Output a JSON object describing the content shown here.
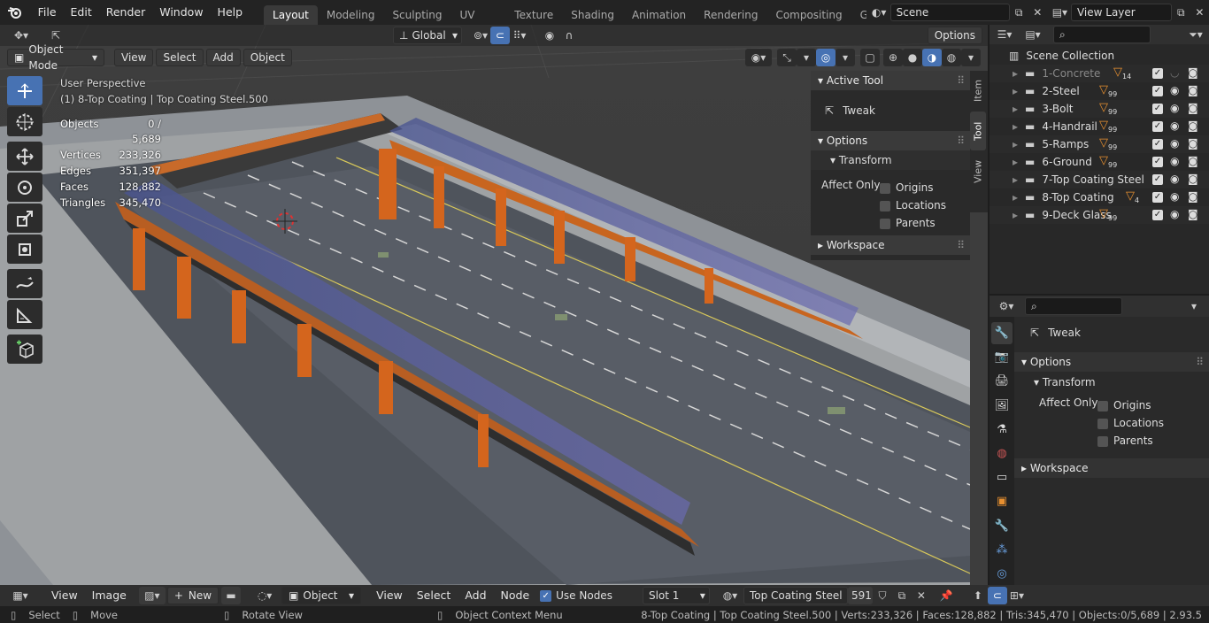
{
  "topbar": {
    "menus": [
      "File",
      "Edit",
      "Render",
      "Window",
      "Help"
    ],
    "workspaces": [
      "Layout",
      "Modeling",
      "Sculpting",
      "UV Editing",
      "Texture Paint",
      "Shading",
      "Animation",
      "Rendering",
      "Compositing",
      "Geometry Nod"
    ],
    "active_workspace": "Layout",
    "scene": "Scene",
    "view_layer": "View Layer"
  },
  "viewport": {
    "orientation": "Global",
    "options_label": "Options",
    "mode": "Object Mode",
    "menus": [
      "View",
      "Select",
      "Add",
      "Object"
    ],
    "overlay_title": "User Perspective",
    "overlay_subtitle": "(1) 8-Top Coating | Top Coating Steel.500",
    "stats": [
      {
        "k": "Objects",
        "v": "0 / 5,689"
      },
      {
        "k": "Vertices",
        "v": "233,326"
      },
      {
        "k": "Edges",
        "v": "351,397"
      },
      {
        "k": "Faces",
        "v": "128,882"
      },
      {
        "k": "Triangles",
        "v": "345,470"
      }
    ]
  },
  "npanel": {
    "active_tool_title": "Active Tool",
    "tool_name": "Tweak",
    "options_title": "Options",
    "transform_title": "Transform",
    "affect_only": "Affect Only",
    "checks": [
      "Origins",
      "Locations",
      "Parents"
    ],
    "workspace_title": "Workspace",
    "tabs": [
      "Item",
      "Tool",
      "View"
    ]
  },
  "outliner": {
    "root": "Scene Collection",
    "items": [
      {
        "name": "1-Concrete",
        "badge": "14",
        "dim": true
      },
      {
        "name": "2-Steel",
        "badge": "99",
        "dim": false
      },
      {
        "name": "3-Bolt",
        "badge": "99",
        "dim": false
      },
      {
        "name": "4-Handrail",
        "badge": "99",
        "dim": false
      },
      {
        "name": "5-Ramps",
        "badge": "99",
        "dim": false
      },
      {
        "name": "6-Ground",
        "badge": "99",
        "dim": false
      },
      {
        "name": "7-Top Coating Steel",
        "badge": "",
        "dim": false
      },
      {
        "name": "8-Top Coating",
        "badge": "4",
        "dim": false
      },
      {
        "name": "9-Deck Glass",
        "badge": "99",
        "dim": false
      }
    ]
  },
  "properties": {
    "tool_name": "Tweak",
    "options_title": "Options",
    "transform_title": "Transform",
    "affect_only": "Affect Only",
    "checks": [
      "Origins",
      "Locations",
      "Parents"
    ],
    "workspace_title": "Workspace"
  },
  "nodebar": {
    "view": "View",
    "image": "Image",
    "new": "New",
    "object": "Object",
    "menus": [
      "View",
      "Select",
      "Add",
      "Node"
    ],
    "use_nodes": "Use Nodes",
    "slot": "Slot 1",
    "material": "Top Coating Steel",
    "users": "591"
  },
  "statusbar": {
    "select": "Select",
    "move": "Move",
    "rotate": "Rotate View",
    "context": "Object Context Menu",
    "info": "8-Top Coating | Top Coating Steel.500 | Verts:233,326 | Faces:128,882 | Tris:345,470 | Objects:0/5,689 | 2.93.5"
  }
}
